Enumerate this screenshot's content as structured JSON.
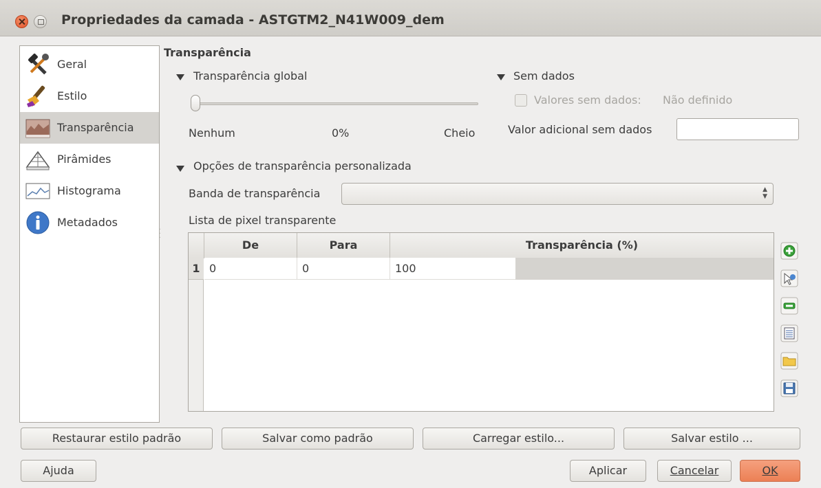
{
  "window": {
    "title": "Propriedades da camada - ASTGTM2_N41W009_dem"
  },
  "sidebar": {
    "items": [
      {
        "label": "Geral",
        "icon": "hammer-wrench-icon"
      },
      {
        "label": "Estilo",
        "icon": "paint-brush-icon"
      },
      {
        "label": "Transparência",
        "icon": "raster-transparency-icon",
        "selected": true
      },
      {
        "label": "Pirâmides",
        "icon": "pyramids-icon"
      },
      {
        "label": "Histograma",
        "icon": "histogram-icon"
      },
      {
        "label": "Metadados",
        "icon": "info-icon"
      }
    ]
  },
  "transparency": {
    "section_title": "Transparência",
    "global": {
      "header": "Transparência global",
      "slider_value_percent": 0,
      "min_label": "Nenhum",
      "value_label": "0%",
      "max_label": "Cheio"
    },
    "nodata": {
      "header": "Sem dados",
      "checkbox_label": "Valores sem dados:",
      "checkbox_value": "Não definido",
      "checked": false,
      "additional_label": "Valor adicional sem dados",
      "additional_value": ""
    },
    "custom": {
      "header": "Opções de transparência personalizada",
      "band_label": "Banda de transparência",
      "band_value": "",
      "pixel_list_label": "Lista de pixel transparente",
      "columns": [
        "De",
        "Para",
        "Transparência (%)"
      ],
      "rows": [
        {
          "num": "1",
          "de": "0",
          "para": "0",
          "transparencia": "100"
        }
      ]
    }
  },
  "tools": [
    {
      "name": "add-value-icon"
    },
    {
      "name": "add-from-display-icon"
    },
    {
      "name": "remove-value-icon"
    },
    {
      "name": "default-values-icon"
    },
    {
      "name": "import-file-icon"
    },
    {
      "name": "export-save-icon"
    }
  ],
  "buttons": {
    "restore_style": "Restaurar estilo padrão",
    "save_default": "Salvar como padrão",
    "load_style": "Carregar estilo...",
    "save_style": "Salvar estilo ...",
    "help": "Ajuda",
    "apply": "Aplicar",
    "cancel": "Cancelar",
    "ok": "OK"
  },
  "colors": {
    "accent_ok": "#ec8055",
    "selected_item": "#d5d3cf",
    "close_button": "#e0532b"
  }
}
